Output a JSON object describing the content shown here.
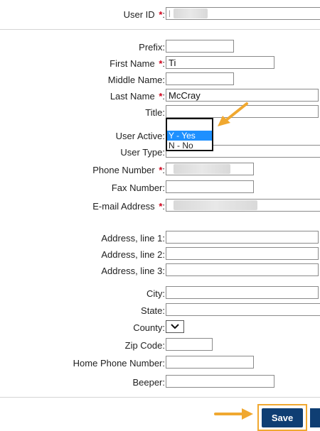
{
  "fields": {
    "user_id": {
      "label": "User ID",
      "required": true,
      "value": "l"
    },
    "prefix": {
      "label": "Prefix:",
      "value": ""
    },
    "first_name": {
      "label": "First Name",
      "required": true,
      "value": "Ti"
    },
    "middle_name": {
      "label": "Middle Name:",
      "value": ""
    },
    "last_name": {
      "label": "Last Name",
      "required": true,
      "value": "McCray"
    },
    "title": {
      "label": "Title:",
      "value": ""
    },
    "user_active": {
      "label": "User Active:",
      "options": [
        "Y - Yes",
        "N - No"
      ],
      "selected": "Y - Yes"
    },
    "user_type": {
      "label": "User Type:",
      "value": ""
    },
    "phone": {
      "label": "Phone Number",
      "required": true
    },
    "fax": {
      "label": "Fax Number:",
      "value": ""
    },
    "email": {
      "label": "E-mail Address",
      "required": true
    },
    "address1": {
      "label": "Address, line 1:",
      "value": ""
    },
    "address2": {
      "label": "Address, line 2:",
      "value": ""
    },
    "address3": {
      "label": "Address, line 3:",
      "value": ""
    },
    "city": {
      "label": "City:",
      "value": ""
    },
    "state": {
      "label": "State:",
      "value": ""
    },
    "county": {
      "label": "County:",
      "value": ""
    },
    "zip": {
      "label": "Zip Code:",
      "value": ""
    },
    "home_phone": {
      "label": "Home Phone Number:",
      "value": ""
    },
    "beeper": {
      "label": "Beeper:",
      "value": ""
    }
  },
  "required_marker": "*",
  "required_suffix": ":",
  "buttons": {
    "save": "Save"
  },
  "colors": {
    "required": "#d0021b",
    "save_button": "#0f3e73",
    "highlight": "#f0a830",
    "selected_option": "#1e90ff"
  },
  "icons": {
    "dropdown_arrow": "chevron-down-icon",
    "callout": "arrow-icon"
  }
}
